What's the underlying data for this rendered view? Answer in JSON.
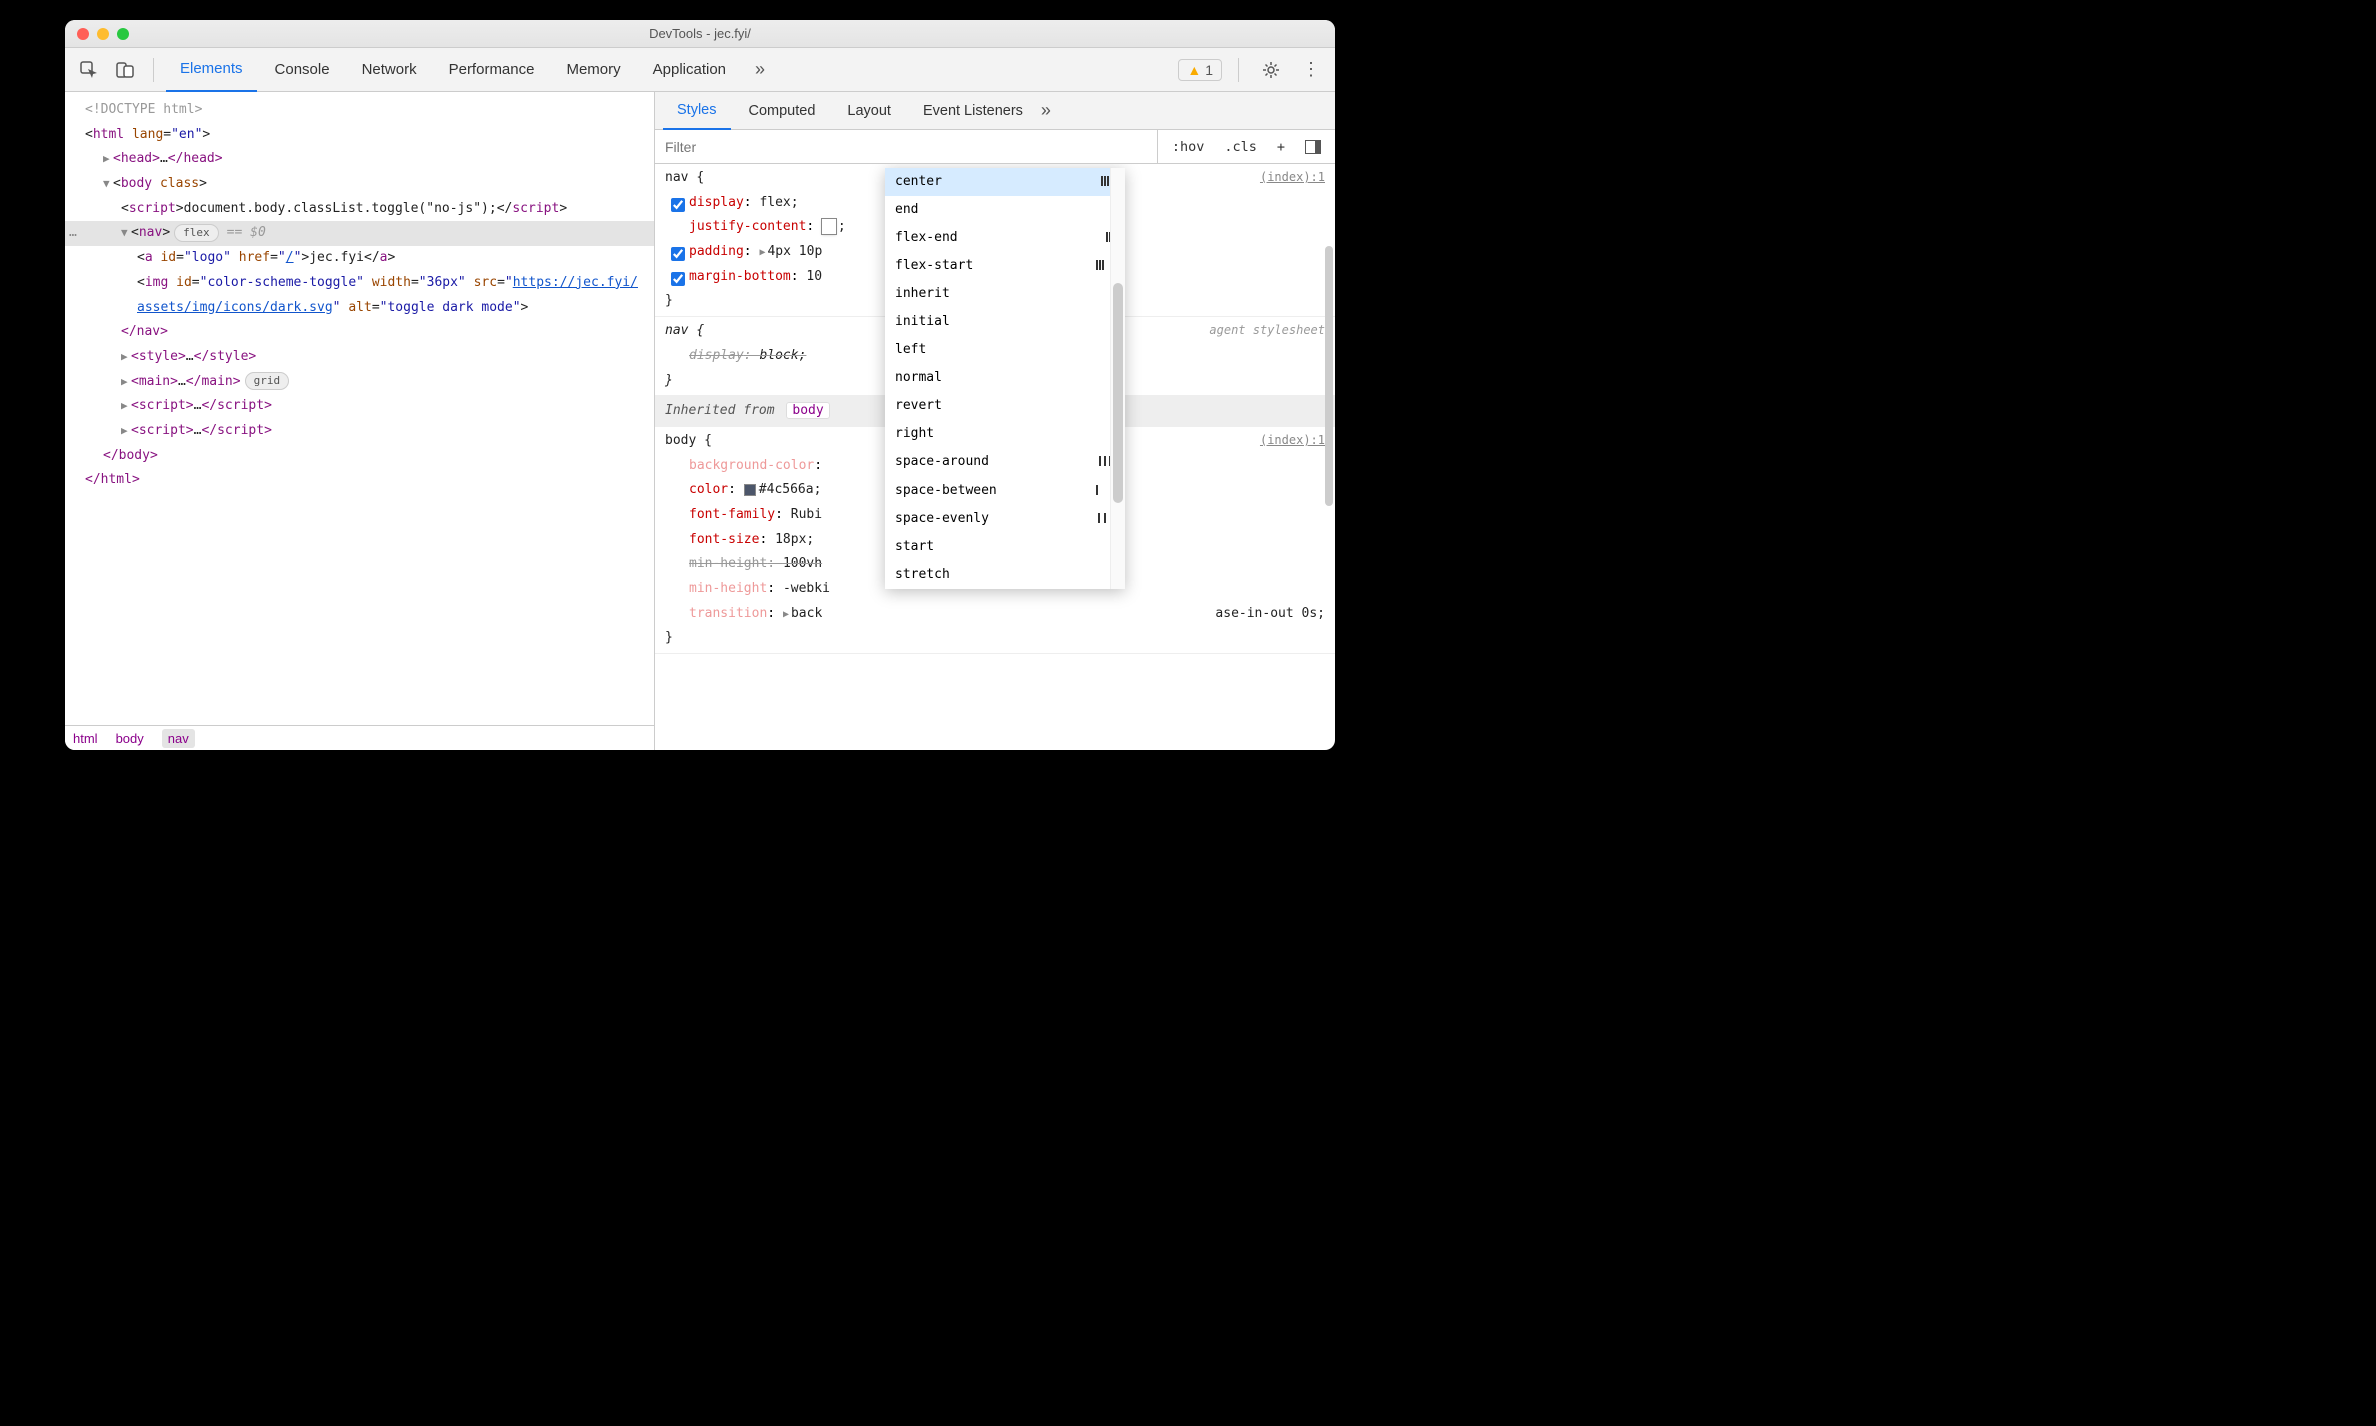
{
  "window": {
    "title": "DevTools - jec.fyi/"
  },
  "tabs": {
    "main": [
      "Elements",
      "Console",
      "Network",
      "Performance",
      "Memory",
      "Application"
    ],
    "active_main": "Elements",
    "right": [
      "Styles",
      "Computed",
      "Layout",
      "Event Listeners"
    ],
    "active_right": "Styles"
  },
  "warnings": {
    "count": "1"
  },
  "breadcrumb": [
    "html",
    "body",
    "nav"
  ],
  "breadcrumb_selected": "nav",
  "dom": {
    "doctype": "<!DOCTYPE html>",
    "html_open": {
      "tag": "html",
      "attrn": "lang",
      "attrv": "\"en\""
    },
    "head": {
      "open": "<head>",
      "dots": "…",
      "close": "</head>"
    },
    "body_open": {
      "tag": "body",
      "attrn": "class"
    },
    "script1": {
      "code": "document.body.classList.toggle(\"no-js\");"
    },
    "nav_open": {
      "tag": "nav",
      "chip": "flex",
      "eq": "== $0"
    },
    "a_logo": {
      "idAttr": "id",
      "idVal": "\"logo\"",
      "hrefAttr": "href",
      "hrefVal": "\"/\"",
      "text": "jec.fyi"
    },
    "img": {
      "idAttr": "id",
      "idVal": "\"color-scheme-toggle\"",
      "widthAttr": "width",
      "widthVal": "\"36px\"",
      "srcAttr": "src",
      "srcVal": "https://jec.fyi/assets/img/icons/dark.svg",
      "altAttr": "alt",
      "altVal": "\"toggle dark mode\""
    },
    "nav_close": "</nav>",
    "style_node": {
      "open": "<style>",
      "dots": "…",
      "close": "</style>"
    },
    "main_node": {
      "open": "<main>",
      "dots": "…",
      "close": "</main>",
      "chip": "grid"
    },
    "script2": {
      "open": "<script>",
      "dots": "…",
      "close": "</script>"
    },
    "script3": {
      "open": "<script>",
      "dots": "…",
      "close": "</script>"
    },
    "body_close": "</body>",
    "html_close": "</html>"
  },
  "filter": {
    "placeholder": "Filter",
    "hov": ":hov",
    "cls": ".cls",
    "plus": "+"
  },
  "rules": {
    "nav": {
      "selector": "nav",
      "source": "(index):1",
      "display": {
        "prop": "display",
        "val": "flex;"
      },
      "justify": {
        "prop": "justify-content",
        "val": ";"
      },
      "padding": {
        "prop": "padding",
        "val": "4px 10p"
      },
      "margin": {
        "prop": "margin-bottom",
        "val": "10"
      }
    },
    "nav_ua": {
      "selector": "nav",
      "source": "agent stylesheet",
      "display": {
        "prop": "display",
        "val": "block;"
      }
    },
    "inherit_label": "Inherited from",
    "inherit_from": "body",
    "body": {
      "selector": "body",
      "source": "(index):1",
      "bg": {
        "prop": "background-color",
        "val": ""
      },
      "color": {
        "prop": "color",
        "val": "#4c566a;"
      },
      "ff": {
        "prop": "font-family",
        "val": "Rubi"
      },
      "fs": {
        "prop": "font-size",
        "val": "18px;"
      },
      "mh1": {
        "prop": "min-height",
        "val": "100vh"
      },
      "mh2": {
        "prop": "min-height",
        "val": "-webki"
      },
      "tr": {
        "prop": "transition",
        "val": "back",
        "tail": "ase-in-out 0s;"
      }
    }
  },
  "autocomplete": {
    "items": [
      {
        "label": "center",
        "icon": "center"
      },
      {
        "label": "end",
        "icon": ""
      },
      {
        "label": "flex-end",
        "icon": "end"
      },
      {
        "label": "flex-start",
        "icon": "start"
      },
      {
        "label": "inherit",
        "icon": ""
      },
      {
        "label": "initial",
        "icon": ""
      },
      {
        "label": "left",
        "icon": ""
      },
      {
        "label": "normal",
        "icon": ""
      },
      {
        "label": "revert",
        "icon": ""
      },
      {
        "label": "right",
        "icon": ""
      },
      {
        "label": "space-around",
        "icon": "around"
      },
      {
        "label": "space-between",
        "icon": "between"
      },
      {
        "label": "space-evenly",
        "icon": "evenly"
      },
      {
        "label": "start",
        "icon": ""
      },
      {
        "label": "stretch",
        "icon": ""
      }
    ],
    "selected": "center"
  }
}
